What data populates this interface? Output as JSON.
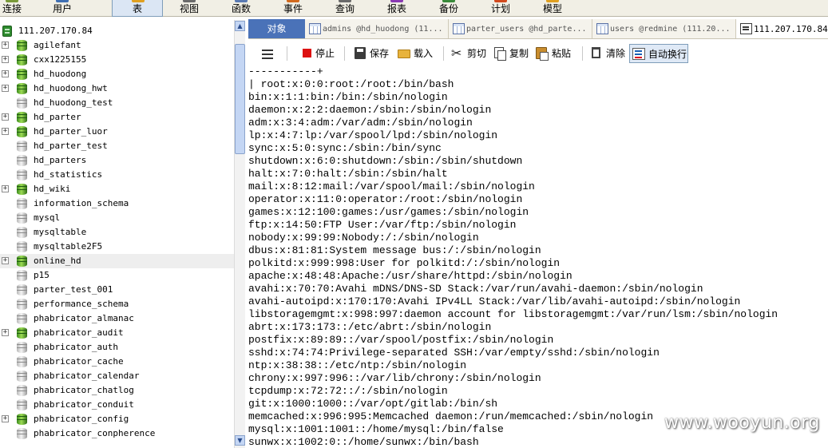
{
  "menubar": {
    "items": [
      {
        "label": "连接",
        "icon": "connection-icon",
        "accent": "#7a9a3a"
      },
      {
        "label": "用户",
        "icon": "user-icon",
        "accent": "#3f6fb3"
      },
      {
        "label": "表",
        "icon": "table-icon",
        "accent": "#e0a020",
        "active": true
      },
      {
        "label": "视图",
        "icon": "view-icon",
        "accent": "#6a6a6a"
      },
      {
        "label": "函数",
        "icon": "function-icon",
        "accent": "#5a7ab3"
      },
      {
        "label": "事件",
        "icon": "event-icon",
        "accent": "#d26a1e"
      },
      {
        "label": "查询",
        "icon": "query-icon",
        "accent": "#6a6a6a"
      },
      {
        "label": "报表",
        "icon": "report-icon",
        "accent": "#8a3ab3"
      },
      {
        "label": "备份",
        "icon": "backup-icon",
        "accent": "#3a8a3a"
      },
      {
        "label": "计划",
        "icon": "schedule-icon",
        "accent": "#d24a1e"
      },
      {
        "label": "模型",
        "icon": "model-icon",
        "accent": "#e0a020"
      }
    ]
  },
  "tree": {
    "server": "111.207.170.84",
    "databases": [
      {
        "name": "agilefant",
        "expandable": true,
        "open": true
      },
      {
        "name": "cxx1225155",
        "expandable": true,
        "open": true
      },
      {
        "name": "hd_huodong",
        "expandable": true,
        "open": true
      },
      {
        "name": "hd_huodong_hwt",
        "expandable": true,
        "open": true
      },
      {
        "name": "hd_huodong_test",
        "expandable": false,
        "open": false
      },
      {
        "name": "hd_parter",
        "expandable": true,
        "open": true
      },
      {
        "name": "hd_parter_luor",
        "expandable": true,
        "open": true
      },
      {
        "name": "hd_parter_test",
        "expandable": false,
        "open": false
      },
      {
        "name": "hd_parters",
        "expandable": false,
        "open": false
      },
      {
        "name": "hd_statistics",
        "expandable": false,
        "open": false
      },
      {
        "name": "hd_wiki",
        "expandable": true,
        "open": true
      },
      {
        "name": "information_schema",
        "expandable": false,
        "open": false
      },
      {
        "name": "mysql",
        "expandable": false,
        "open": false
      },
      {
        "name": "mysqltable",
        "expandable": false,
        "open": false
      },
      {
        "name": "mysqltable2F5",
        "expandable": false,
        "open": false
      },
      {
        "name": "online_hd",
        "expandable": true,
        "open": true,
        "selected": true
      },
      {
        "name": "p15",
        "expandable": false,
        "open": false
      },
      {
        "name": "parter_test_001",
        "expandable": false,
        "open": false
      },
      {
        "name": "performance_schema",
        "expandable": false,
        "open": false
      },
      {
        "name": "phabricator_almanac",
        "expandable": false,
        "open": false
      },
      {
        "name": "phabricator_audit",
        "expandable": true,
        "open": true
      },
      {
        "name": "phabricator_auth",
        "expandable": false,
        "open": false
      },
      {
        "name": "phabricator_cache",
        "expandable": false,
        "open": false
      },
      {
        "name": "phabricator_calendar",
        "expandable": false,
        "open": false
      },
      {
        "name": "phabricator_chatlog",
        "expandable": false,
        "open": false
      },
      {
        "name": "phabricator_conduit",
        "expandable": false,
        "open": false
      },
      {
        "name": "phabricator_config",
        "expandable": true,
        "open": true
      },
      {
        "name": "phabricator_conpherence",
        "expandable": false,
        "open": false
      }
    ]
  },
  "tabs": [
    {
      "label": "对象",
      "icon": "",
      "kind": "objects"
    },
    {
      "label": "admins @hd_huodong (11...",
      "icon": "table-grid-icon",
      "kind": "table"
    },
    {
      "label": "parter_users @hd_parte...",
      "icon": "table-grid-icon",
      "kind": "table"
    },
    {
      "label": "users @redmine (111.20...",
      "icon": "table-grid-icon",
      "kind": "table"
    },
    {
      "label": "111.207.170.84 - ",
      "icon": "console-icon",
      "kind": "console",
      "active": true
    }
  ],
  "toolbar": {
    "menu": "menu-icon",
    "stop": "停止",
    "save": "保存",
    "load": "载入",
    "cut": "剪切",
    "copy": "复制",
    "paste": "粘贴",
    "clear": "清除",
    "wrap": "自动换行"
  },
  "output": {
    "lines": [
      "-----------+",
      "| root:x:0:0:root:/root:/bin/bash",
      "bin:x:1:1:bin:/bin:/sbin/nologin",
      "daemon:x:2:2:daemon:/sbin:/sbin/nologin",
      "adm:x:3:4:adm:/var/adm:/sbin/nologin",
      "lp:x:4:7:lp:/var/spool/lpd:/sbin/nologin",
      "sync:x:5:0:sync:/sbin:/bin/sync",
      "shutdown:x:6:0:shutdown:/sbin:/sbin/shutdown",
      "halt:x:7:0:halt:/sbin:/sbin/halt",
      "mail:x:8:12:mail:/var/spool/mail:/sbin/nologin",
      "operator:x:11:0:operator:/root:/sbin/nologin",
      "games:x:12:100:games:/usr/games:/sbin/nologin",
      "ftp:x:14:50:FTP User:/var/ftp:/sbin/nologin",
      "nobody:x:99:99:Nobody:/:/sbin/nologin",
      "dbus:x:81:81:System message bus:/:/sbin/nologin",
      "polkitd:x:999:998:User for polkitd:/:/sbin/nologin",
      "apache:x:48:48:Apache:/usr/share/httpd:/sbin/nologin",
      "avahi:x:70:70:Avahi mDNS/DNS-SD Stack:/var/run/avahi-daemon:/sbin/nologin",
      "avahi-autoipd:x:170:170:Avahi IPv4LL Stack:/var/lib/avahi-autoipd:/sbin/nologin",
      "libstoragemgmt:x:998:997:daemon account for libstoragemgmt:/var/run/lsm:/sbin/nologin",
      "abrt:x:173:173::/etc/abrt:/sbin/nologin",
      "postfix:x:89:89::/var/spool/postfix:/sbin/nologin",
      "sshd:x:74:74:Privilege-separated SSH:/var/empty/sshd:/sbin/nologin",
      "ntp:x:38:38::/etc/ntp:/sbin/nologin",
      "chrony:x:997:996::/var/lib/chrony:/sbin/nologin",
      "tcpdump:x:72:72::/:/sbin/nologin",
      "git:x:1000:1000::/var/opt/gitlab:/bin/sh",
      "memcached:x:996:995:Memcached daemon:/run/memcached:/sbin/nologin",
      "mysql:x:1001:1001::/home/mysql:/bin/false",
      "sunwx:x:1002:0::/home/sunwx:/bin/bash"
    ]
  },
  "watermark": "www.wooyun.org"
}
